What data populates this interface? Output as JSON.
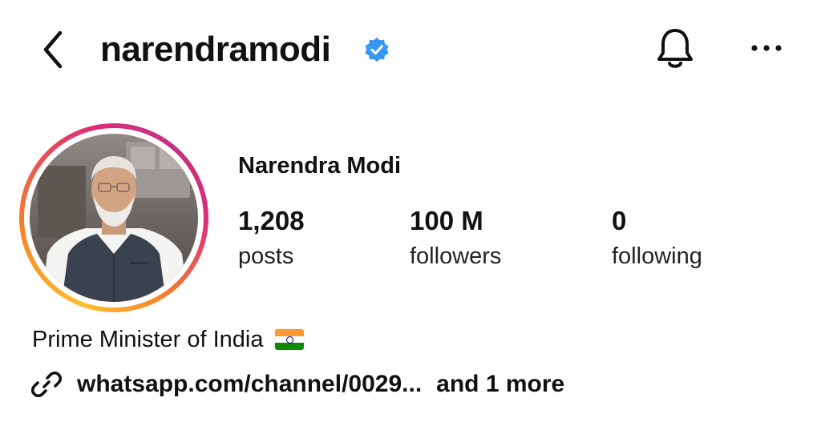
{
  "header": {
    "username": "narendramodi",
    "verified": true,
    "icons": {
      "back": "chevron-left-icon",
      "verified": "verified-badge-icon",
      "notifications": "bell-icon",
      "more": "more-horizontal-icon"
    }
  },
  "profile": {
    "full_name": "Narendra Modi",
    "stats": {
      "posts": {
        "value": "1,208",
        "label": "posts"
      },
      "followers": {
        "value": "100 M",
        "label": "followers"
      },
      "following": {
        "value": "0",
        "label": "following"
      }
    },
    "bio": "Prime Minister of India",
    "bio_emoji": "india-flag-icon",
    "link": {
      "text": "whatsapp.com/channel/0029...",
      "more": "and 1 more",
      "icon": "link-icon"
    }
  },
  "colors": {
    "text": "#111111",
    "verified_blue": "#3897f0",
    "story_ring": [
      "#fdc030",
      "#f58529",
      "#dd2a7b",
      "#c13584"
    ]
  }
}
